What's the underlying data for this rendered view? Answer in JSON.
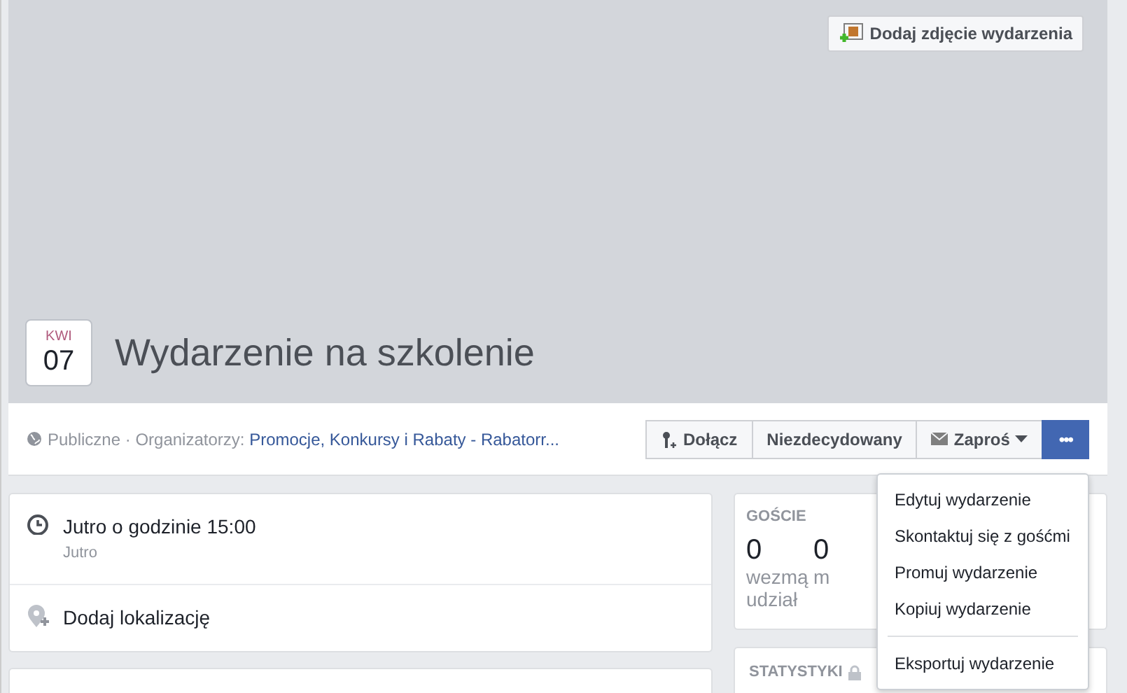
{
  "cover": {
    "add_photo_button": "Dodaj zdjęcie wydarzenia"
  },
  "event": {
    "month": "KWI",
    "day": "07",
    "title": "Wydarzenie na szkolenie"
  },
  "meta": {
    "privacy": "Publiczne",
    "separator": "·",
    "organizers_label": "Organizatorzy:",
    "organizers": "Promocje, Konkursy i Rabaty - Rabatorr..."
  },
  "actions": [
    {
      "kind": "join",
      "label": "Dołącz"
    },
    {
      "kind": "plain",
      "label": "Niezdecydowany"
    },
    {
      "kind": "invite",
      "label": "Zaproś"
    },
    {
      "kind": "more",
      "label": "•••",
      "selected": true
    }
  ],
  "details": [
    {
      "kind": "time",
      "text": "Jutro o godzinie 15:00",
      "subtext": "Jutro"
    },
    {
      "kind": "location",
      "text": "Dodaj lokalizację"
    }
  ],
  "guests": {
    "heading": "GOŚCIE",
    "stats": [
      {
        "count": "0",
        "label": "wezmą udział"
      },
      {
        "count": "0",
        "label": "m"
      }
    ]
  },
  "statistics": {
    "heading": "STATYSTYKI"
  },
  "menu": {
    "open": true,
    "groups": [
      [
        "Edytuj wydarzenie",
        "Skontaktuj się z gośćmi",
        "Promuj wydarzenie",
        "Kopiuj wydarzenie"
      ],
      [
        "Eksportuj wydarzenie"
      ]
    ]
  }
}
